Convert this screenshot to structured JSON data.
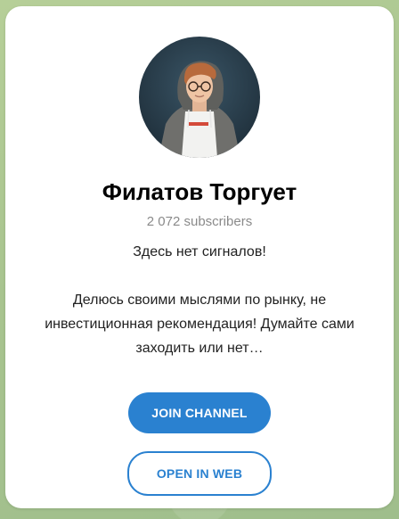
{
  "channel": {
    "name": "Филатов Торгует",
    "subscribers": "2 072 subscribers",
    "description": {
      "line1": "Здесь нет сигналов!",
      "line2": "Делюсь своими мыслями по рынку, не инвестиционная рекомендация! Думайте сами заходить или нет…"
    }
  },
  "actions": {
    "join_label": "JOIN CHANNEL",
    "open_web_label": "OPEN IN WEB"
  },
  "colors": {
    "accent": "#2a81d0",
    "background": "#a9c795",
    "card": "#ffffff"
  },
  "icons": {
    "avatar": "channel-avatar-photo"
  }
}
